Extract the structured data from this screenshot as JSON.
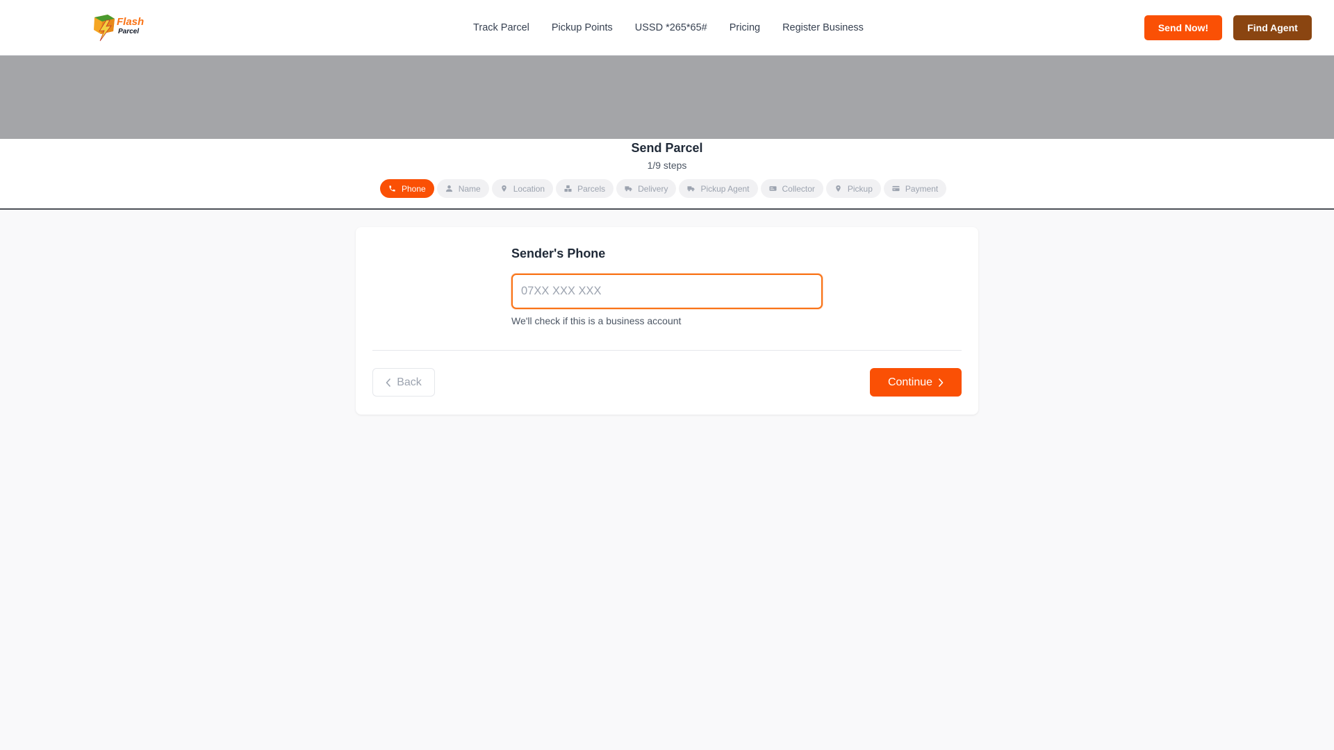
{
  "header": {
    "logo_text": "Flash Parcel",
    "nav": [
      {
        "label": "Track Parcel"
      },
      {
        "label": "Pickup Points"
      },
      {
        "label": "USSD *265*65#"
      },
      {
        "label": "Pricing"
      },
      {
        "label": "Register Business"
      }
    ],
    "send_now_label": "Send Now!",
    "find_agent_label": "Find Agent"
  },
  "stepper": {
    "title": "Send Parcel",
    "count": "1/9 steps",
    "steps": [
      {
        "label": "Phone",
        "icon": "phone-icon",
        "active": true
      },
      {
        "label": "Name",
        "icon": "user-icon",
        "active": false
      },
      {
        "label": "Location",
        "icon": "map-pin-icon",
        "active": false
      },
      {
        "label": "Parcels",
        "icon": "boxes-icon",
        "active": false
      },
      {
        "label": "Delivery",
        "icon": "truck-icon",
        "active": false
      },
      {
        "label": "Pickup Agent",
        "icon": "truck-icon",
        "active": false
      },
      {
        "label": "Collector",
        "icon": "id-card-icon",
        "active": false
      },
      {
        "label": "Pickup",
        "icon": "map-pin-icon",
        "active": false
      },
      {
        "label": "Payment",
        "icon": "credit-card-icon",
        "active": false
      }
    ]
  },
  "form": {
    "label": "Sender's Phone",
    "phone_value": "",
    "phone_placeholder": "07XX XXX XXX",
    "hint": "We'll check if this is a business account",
    "back_label": "Back",
    "continue_label": "Continue"
  },
  "colors": {
    "accent": "#fa5005",
    "find_agent": "#8a4511",
    "input_focus": "#f97316"
  }
}
